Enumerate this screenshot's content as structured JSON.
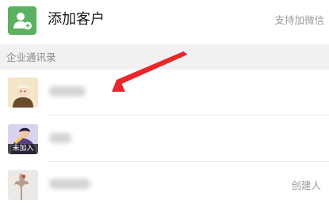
{
  "add_customer": {
    "title": "添加客户",
    "support_text": "支持加微信"
  },
  "section": {
    "title": "企业通讯录"
  },
  "contacts": [
    {
      "name_blurred": true
    },
    {
      "name_blurred": true,
      "avatar_tag": "未加入"
    },
    {
      "name_blurred": true,
      "role": "创建人"
    }
  ],
  "colors": {
    "accent": "#5bb061",
    "annotation_arrow": "#e8262b",
    "section_bg": "#f1f1f1"
  },
  "icons": {
    "add_customer": "person-add-icon"
  }
}
